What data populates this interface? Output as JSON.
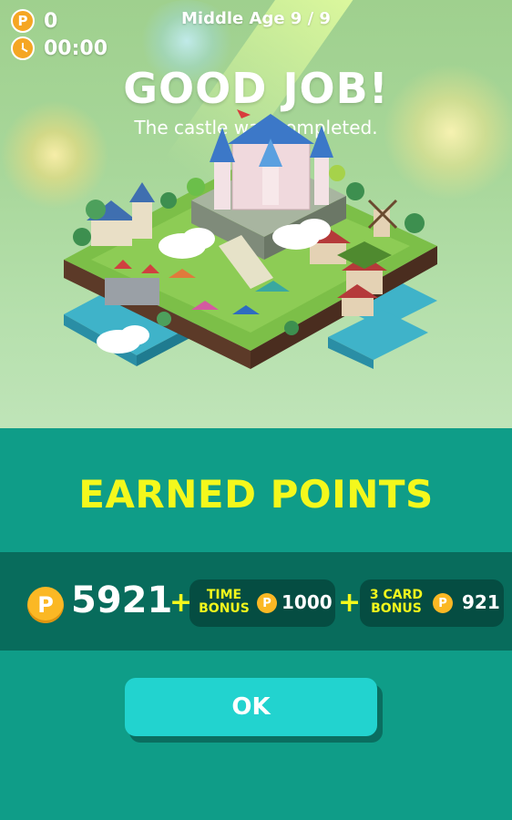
{
  "hud": {
    "points_value": "0",
    "timer_value": "00:00",
    "points_icon_letter": "P"
  },
  "stage": {
    "label": "Middle Age 9 / 9"
  },
  "result": {
    "title": "GOOD JOB!",
    "subtitle": "The castle was completed."
  },
  "earned": {
    "title": "EARNED POINTS",
    "total": "5921",
    "plus": "+",
    "coin_letter": "P",
    "time_bonus": {
      "label_line1": "TIME",
      "label_line2": "BONUS",
      "value": "1000"
    },
    "card_bonus": {
      "label_line1": "3 CARD",
      "label_line2": "BONUS",
      "value": "921"
    }
  },
  "actions": {
    "ok_label": "OK"
  },
  "colors": {
    "accent_yellow": "#f4f81c",
    "panel_teal": "#0f9d88",
    "band_dark": "#086c5c",
    "coin_gold": "#fbb824",
    "ok_button": "#22d3cf"
  }
}
